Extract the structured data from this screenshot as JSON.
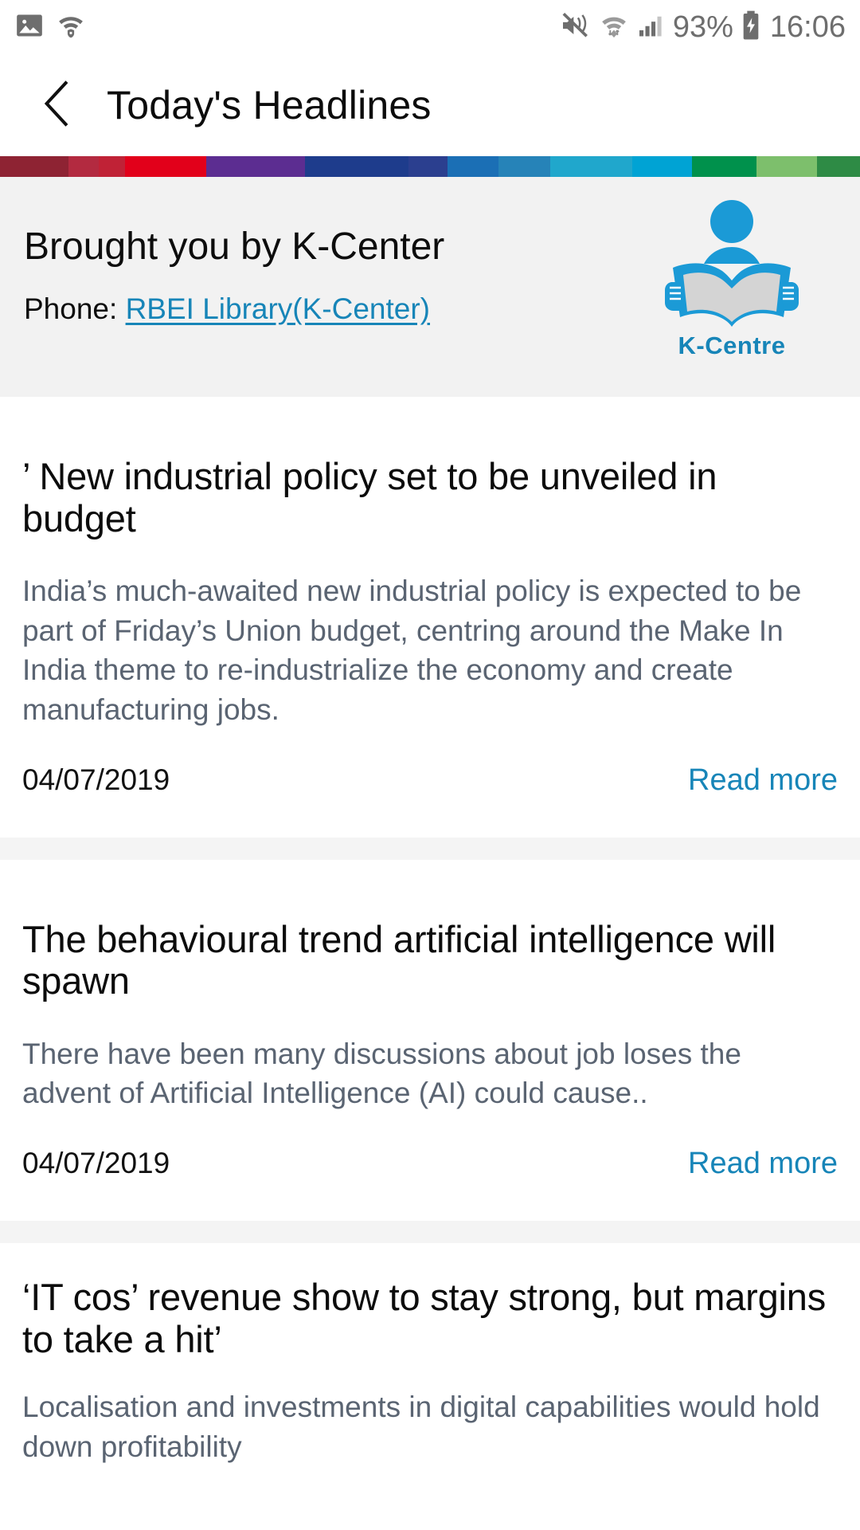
{
  "status_bar": {
    "left_icons": [
      "image-icon",
      "wifi-shield-icon"
    ],
    "right_icons": [
      "mute-vibrate-icon",
      "wifi-icon",
      "signal-icon",
      "battery-charging-icon"
    ],
    "battery_percent": "93%",
    "time": "16:06"
  },
  "app_bar": {
    "back_icon": "back-chevron-icon",
    "title": "Today's Headlines"
  },
  "stripe": {
    "colors": [
      "#8e2333",
      "#b32a40",
      "#e2001a",
      "#5c2d91",
      "#1e3c8c",
      "#1b6fb5",
      "#2683b8",
      "#20a7cc",
      "#00a3d4",
      "#00914c",
      "#7dbf6c",
      "#2e8b45"
    ]
  },
  "sponsor": {
    "title": "Brought you by K-Center",
    "phone_label": "Phone:",
    "phone_link": "RBEI Library(K-Center)",
    "logo_name": "k-centre-reader-logo",
    "logo_word": "K-Centre",
    "logo_color": "#1b9ad6",
    "book_color": "#d4d4d4",
    "background": "#f2f2f2"
  },
  "link_color": "#1785b8",
  "articles": [
    {
      "title": "’ New industrial policy set to be unveiled in budget",
      "body": " India’s much-awaited new industrial policy is expected to be part of Friday’s Union budget, centring around the Make In India theme to re-industrialize the economy and create manufacturing jobs.",
      "date": "04/07/2019",
      "read_more": "Read more"
    },
    {
      "title": "The behavioural trend artificial intelligence will spawn",
      "body": "There have been many discussions about job loses the advent of Artificial Intelligence (AI) could cause..",
      "date": "04/07/2019",
      "read_more": "Read more"
    },
    {
      "title": "‘IT cos’ revenue show to stay strong, but margins to take a hit’",
      "body": "Localisation and investments in digital capabilities would hold down profitability",
      "date": "",
      "read_more": ""
    }
  ]
}
